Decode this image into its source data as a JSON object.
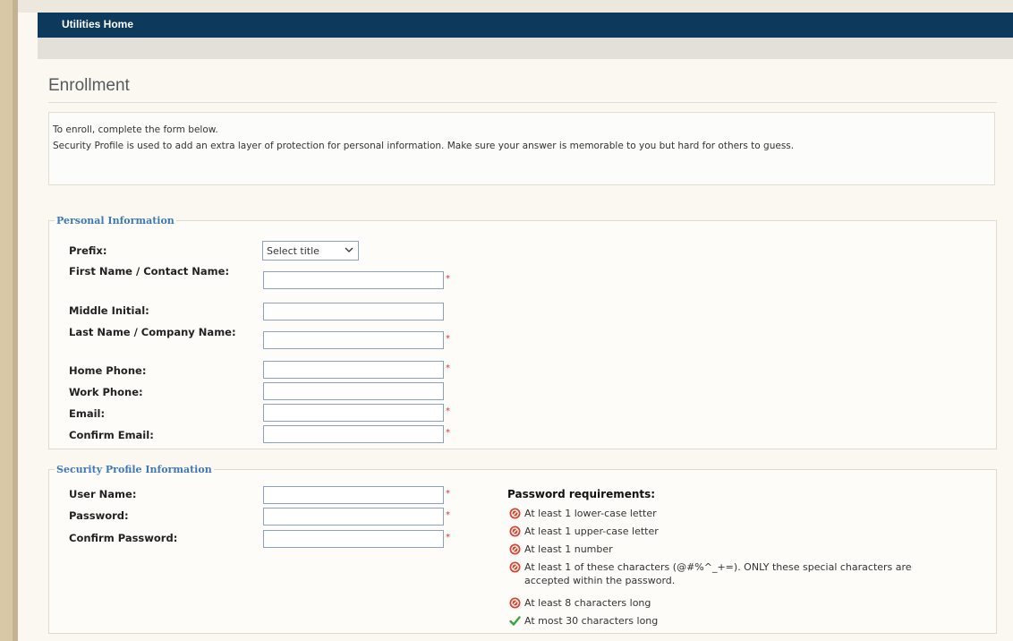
{
  "nav": {
    "home_label": "Utilities Home"
  },
  "page": {
    "title": "Enrollment"
  },
  "intro": {
    "line1": "To enroll, complete the form below.",
    "line2": "Security Profile is used to add an extra layer of protection for personal information. Make sure your answer is memorable to you but hard for others to guess."
  },
  "personal": {
    "legend": "Personal Information",
    "prefix_label": "Prefix:",
    "prefix_value": "Select title",
    "first_name_label": "First Name / Contact Name:",
    "middle_initial_label": "Middle Initial:",
    "last_name_label": "Last Name / Company Name:",
    "home_phone_label": "Home Phone:",
    "work_phone_label": "Work Phone:",
    "email_label": "Email:",
    "confirm_email_label": "Confirm Email:"
  },
  "security": {
    "legend": "Security Profile Information",
    "username_label": "User Name:",
    "password_label": "Password:",
    "confirm_password_label": "Confirm Password:",
    "requirements_title": "Password requirements:",
    "requirements": [
      {
        "text": "At least 1 lower-case letter",
        "met": false,
        "icon": "error-icon"
      },
      {
        "text": "At least 1 upper-case letter",
        "met": false,
        "icon": "error-icon"
      },
      {
        "text": "At least 1 number",
        "met": false,
        "icon": "error-icon"
      },
      {
        "text": "At least 1 of these characters (@#%^_+=). ONLY these special characters are accepted within the password.",
        "met": false,
        "icon": "error-icon"
      },
      {
        "text": "At least 8 characters long",
        "met": false,
        "icon": "error-icon"
      },
      {
        "text": "At most 30 characters long",
        "met": true,
        "icon": "checkmark-icon"
      }
    ]
  },
  "required_marker": "*",
  "colors": {
    "navbar": "#0d3a5c",
    "legend": "#3f79b5",
    "error": "#d9442e",
    "success": "#3aa53a",
    "required": "#dd3333"
  }
}
